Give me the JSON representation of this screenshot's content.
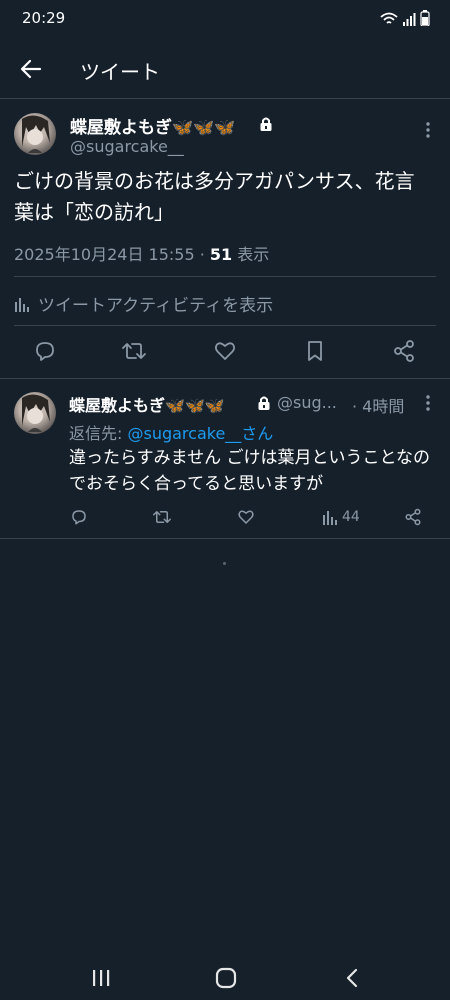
{
  "status_bar": {
    "time": "20:29"
  },
  "header": {
    "title": "ツイート"
  },
  "tweet": {
    "display_name": "蝶屋敷よもぎ",
    "butterflies": "🦋🦋🦋",
    "handle": "@sugarcake__",
    "text": "ごけの背景のお花は多分アガパンサス、花言葉は「恋の訪れ」",
    "date": "2025年10月24日 15:55 · ",
    "view_count": "51",
    "view_label": " 表示",
    "activity_label": "ツイートアクティビティを表示"
  },
  "reply": {
    "display_name": "蝶屋敷よもぎ",
    "butterflies": "🦋🦋🦋",
    "handle": "@sug...",
    "time": "· 4時間",
    "reply_to_prefix": "返信先: ",
    "reply_to_mention": "@sugarcake__さん",
    "text": "違ったらすみません ごけは葉月ということなのでおそらく合ってると思いますが",
    "view_count": "44"
  },
  "colors": {
    "background": "#15202b",
    "divider": "#38444d",
    "secondary_text": "#8b98a5",
    "accent": "#1d9bf0",
    "butterfly": "#e8912d"
  },
  "icons": {
    "back": "arrow-left-icon",
    "lock": "lock-icon",
    "more": "more-vertical-icon",
    "reply": "reply-icon",
    "retweet": "retweet-icon",
    "like": "heart-icon",
    "bookmark": "bookmark-icon",
    "share": "share-icon",
    "analytics": "bar-chart-icon"
  }
}
